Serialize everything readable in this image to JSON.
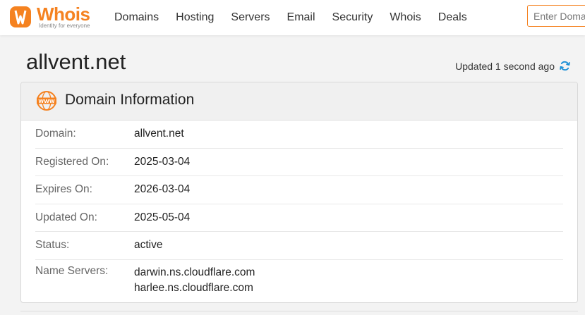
{
  "brand": {
    "name": "Whois",
    "tagline": "Identity for everyone",
    "accent": "#f58220"
  },
  "nav": {
    "items": [
      "Domains",
      "Hosting",
      "Servers",
      "Email",
      "Security",
      "Whois",
      "Deals"
    ]
  },
  "search": {
    "placeholder": "Enter Domain"
  },
  "page": {
    "title": "allvent.net",
    "updated": "Updated 1 second ago"
  },
  "card": {
    "title": "Domain Information",
    "rows": [
      {
        "label": "Domain:",
        "value": "allvent.net"
      },
      {
        "label": "Registered On:",
        "value": "2025-03-04"
      },
      {
        "label": "Expires On:",
        "value": "2026-03-04"
      },
      {
        "label": "Updated On:",
        "value": "2025-05-04"
      },
      {
        "label": "Status:",
        "value": "active"
      },
      {
        "label": "Name Servers:",
        "values": [
          "darwin.ns.cloudflare.com",
          "harlee.ns.cloudflare.com"
        ]
      }
    ]
  },
  "icons": {
    "logo": "whois-logo-icon",
    "refresh": "refresh-icon",
    "www": "www-globe-icon"
  }
}
